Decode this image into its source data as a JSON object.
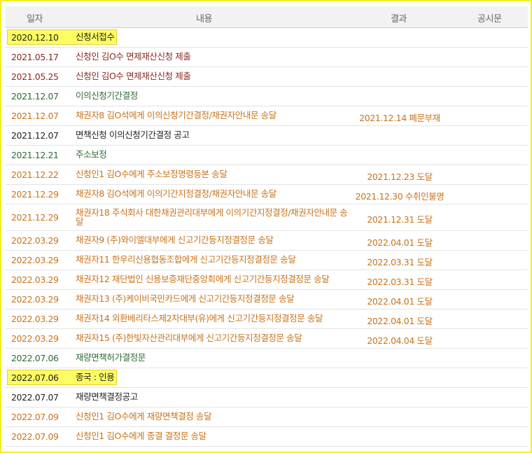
{
  "header": {
    "date": "일자",
    "content": "내용",
    "result": "결과",
    "notice": "공시문"
  },
  "colors": {
    "black": "#222222",
    "green": "#2e6b32",
    "orange": "#c8731c",
    "maroon": "#8a2a22"
  },
  "rows": [
    {
      "date": "2020.12.10",
      "content": "신청서접수",
      "result": "",
      "color": "#222222",
      "highlight": true
    },
    {
      "date": "2021.05.17",
      "content": "신청인 김O수 면제재산신청 제출",
      "result": "",
      "color": "#8a2a22"
    },
    {
      "date": "2021.05.25",
      "content": "신청인 김O수 면제재산신청 제출",
      "result": "",
      "color": "#8a2a22"
    },
    {
      "date": "2021.12.07",
      "content": "이의신청기간결정",
      "result": "",
      "color": "#2e6b32"
    },
    {
      "date": "2021.12.07",
      "content": "채권자8 김O석에게 이의신청기간결정/채권자안내문 송달",
      "result": "2021.12.14 폐문부재",
      "color": "#c8731c"
    },
    {
      "date": "2021.12.07",
      "content": "면책신청 이의신청기간결정 공고",
      "result": "",
      "color": "#222222"
    },
    {
      "date": "2021.12.21",
      "content": "주소보정",
      "result": "",
      "color": "#2e6b32"
    },
    {
      "date": "2021.12.22",
      "content": "신청인1 김O수에게 주소보정명령등본 송달",
      "result": "2021.12.23 도달",
      "color": "#c8731c"
    },
    {
      "date": "2021.12.29",
      "content": "채권자8 김O석에게 이의기간지정결정/채권자안내문 송달",
      "result": "2021.12.30 수취인불명",
      "color": "#c8731c"
    },
    {
      "date": "2021.12.29",
      "content": "채권자18 주식회사 대한채권관리대부에게 이의기간지정결정/채권자안내문 송달",
      "result": "2021.12.31 도달",
      "color": "#c8731c",
      "tall": true
    },
    {
      "date": "2022.03.29",
      "content": "채권자9 (주)와이엘대부에게 신고기간등지정결정문 송달",
      "result": "2022.04.01 도달",
      "color": "#c8731c"
    },
    {
      "date": "2022.03.29",
      "content": "채권자11 한우리신용협동조합에게 신고기간등지정결정문 송달",
      "result": "2022.03.31 도달",
      "color": "#c8731c"
    },
    {
      "date": "2022.03.29",
      "content": "채권자12 재단법인 신용보증재단중앙회에게 신고기간등지정결정문 송달",
      "result": "2022.03.31 도달",
      "color": "#c8731c"
    },
    {
      "date": "2022.03.29",
      "content": "채권자13 (주)케이비국민카드에게 신고기간등지정결정문 송달",
      "result": "2022.04.01 도달",
      "color": "#c8731c"
    },
    {
      "date": "2022.03.29",
      "content": "채권자14 외환베리타스제2차대부(유)에게 신고기간등지정결정문 송달",
      "result": "2022.04.01 도달",
      "color": "#c8731c"
    },
    {
      "date": "2022.03.29",
      "content": "채권자15 (주)한빛자산관리대부에게 신고기간등지정결정문 송달",
      "result": "2022.04.04 도달",
      "color": "#c8731c"
    },
    {
      "date": "2022.07.06",
      "content": "재량면책허가결정문",
      "result": "",
      "color": "#2e6b32"
    },
    {
      "date": "2022.07.06",
      "content": "종국 : 인용",
      "result": "",
      "color": "#222222",
      "highlight": true
    },
    {
      "date": "2022.07.07",
      "content": "재량면책결정공고",
      "result": "",
      "color": "#222222"
    },
    {
      "date": "2022.07.09",
      "content": "신청인1 김O수에게 재량면책결정 송달",
      "result": "",
      "color": "#c8731c"
    },
    {
      "date": "2022.07.09",
      "content": "신청인1 김O수에게 종결 결정문 송달",
      "result": "",
      "color": "#c8731c"
    }
  ]
}
